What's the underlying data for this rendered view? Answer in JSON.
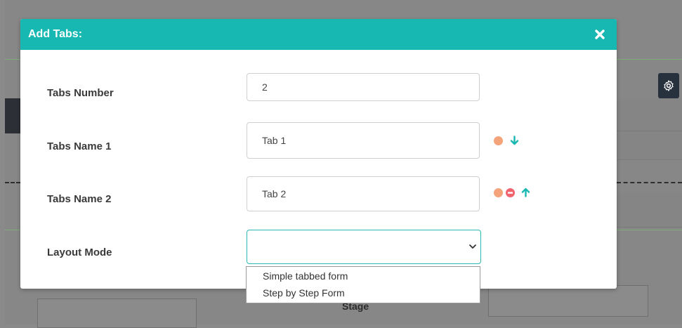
{
  "modal": {
    "title": "Add Tabs:",
    "fields": {
      "tabs_number": {
        "label": "Tabs Number",
        "value": "2"
      },
      "tab_name_1": {
        "label": "Tabs Name 1",
        "value": "Tab 1"
      },
      "tab_name_2": {
        "label": "Tabs Name 2",
        "value": "Tab 2"
      },
      "layout_mode": {
        "label": "Layout Mode",
        "value": ""
      }
    },
    "layout_options": [
      "Simple tabbed form",
      "Step by Step Form"
    ]
  },
  "background": {
    "stage_label": "Stage"
  },
  "colors": {
    "header": "#17b7b2",
    "dot_orange": "#f4a37a",
    "remove_red": "#f06470",
    "arrow_teal": "#17b7b2",
    "select_focus_border": "#2bb8b3"
  },
  "icons": [
    "close-icon",
    "settings-gear-icon",
    "arrow-down-icon",
    "arrow-up-icon",
    "remove-icon",
    "chevron-down-icon"
  ]
}
